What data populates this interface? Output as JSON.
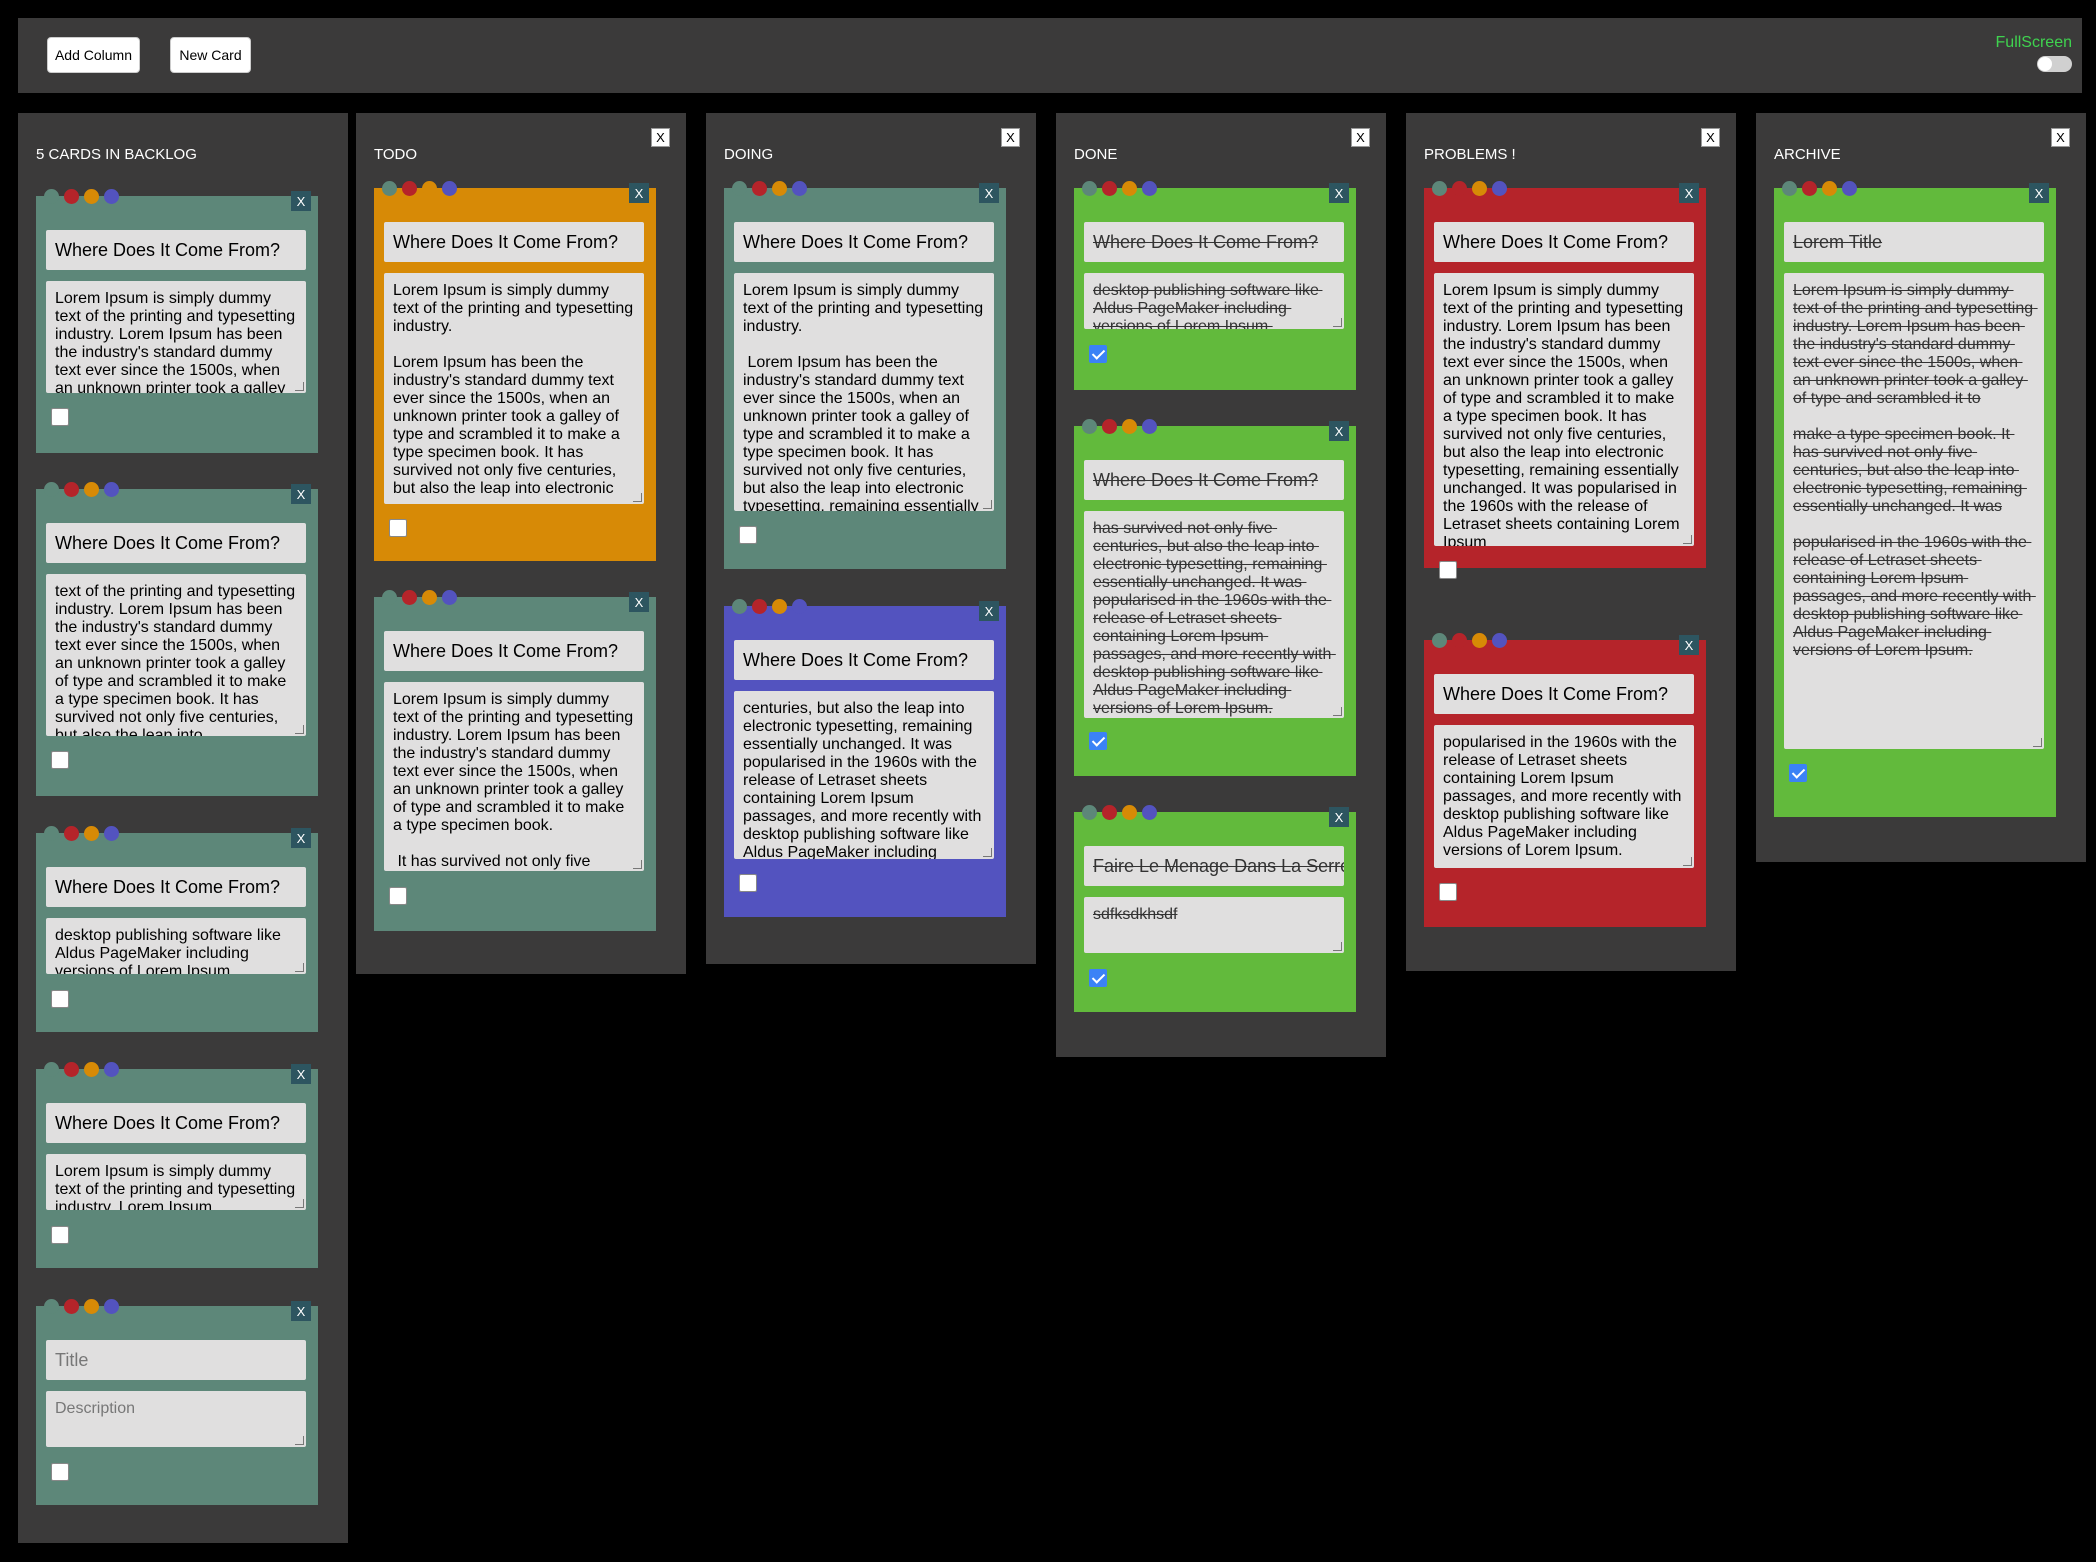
{
  "toolbar": {
    "add_column_label": "Add Column",
    "new_card_label": "New Card",
    "fullscreen_label": "FullScreen"
  },
  "colors": {
    "teal": "#5d8779",
    "orange": "#d78a06",
    "red": "#b5242a",
    "blue": "#5353bf",
    "green": "#62ba3c",
    "panel": "#3b3a3a"
  },
  "close_label": "X",
  "columns": {
    "backlog": {
      "title": "5 CARDS IN BACKLOG",
      "cards": [
        {
          "title": "Where Does It Come From?",
          "desc": "Lorem Ipsum is simply dummy text of the printing and typesetting industry. Lorem Ipsum has been the industry's standard dummy text ever since the 1500s, when an unknown printer took a galley of type"
        },
        {
          "title": "Where Does It Come From?",
          "desc": "text of the printing and typesetting industry. Lorem Ipsum has been the industry's standard dummy text ever since the 1500s, when an unknown printer took a galley of type and scrambled it to make a type specimen book. It has survived not only five centuries, but also the leap into"
        },
        {
          "title": "Where Does It Come From?",
          "desc": "desktop publishing software like Aldus PageMaker including versions of Lorem Ipsum."
        },
        {
          "title": "Where Does It Come From?",
          "desc": "Lorem Ipsum is simply dummy text of the printing and typesetting industry. Lorem Ipsum"
        },
        {
          "title_placeholder": "Title",
          "desc_placeholder": "Description"
        }
      ]
    },
    "todo": {
      "title": "TODO",
      "cards": [
        {
          "title": "Where Does It Come From?",
          "desc": "Lorem Ipsum is simply dummy text of the printing and typesetting industry.\n\nLorem Ipsum has been the industry's standard dummy text ever since the 1500s, when an unknown printer took a galley of type and scrambled it to make a type specimen book. It has survived not only five centuries, but also the leap into electronic"
        },
        {
          "title": "Where Does It Come From?",
          "desc": "Lorem Ipsum is simply dummy text of the printing and typesetting industry. Lorem Ipsum has been the industry's standard dummy text ever since the 1500s, when an unknown printer took a galley of type and scrambled it to make a type specimen book.\n\n It has survived not only five"
        }
      ]
    },
    "doing": {
      "title": "DOING",
      "cards": [
        {
          "title": "Where Does It Come From?",
          "desc": "Lorem Ipsum is simply dummy text of the printing and typesetting industry.\n\n Lorem Ipsum has been the industry's standard dummy text ever since the 1500s, when an unknown printer took a galley of type and scrambled it to make a type specimen book. It has survived not only five centuries, but also the leap into electronic typesetting, remaining essentially"
        },
        {
          "title": "Where Does It Come From?",
          "desc": "centuries, but also the leap into electronic typesetting, remaining essentially unchanged. It was popularised in the 1960s with the release of Letraset sheets containing Lorem Ipsum passages, and more recently with desktop publishing software like Aldus PageMaker including versions of Lorem Ipsum."
        }
      ]
    },
    "done": {
      "title": "DONE",
      "cards": [
        {
          "title": "Where Does It Come From?",
          "desc": "desktop publishing software like Aldus PageMaker including versions of Lorem Ipsum."
        },
        {
          "title": "Where Does It Come From?",
          "desc": "has survived not only five centuries, but also the leap into electronic typesetting, remaining essentially unchanged. It was popularised in the 1960s with the release of Letraset sheets containing Lorem Ipsum passages, and more recently with desktop publishing software like Aldus PageMaker including versions of Lorem Ipsum."
        },
        {
          "title": "Faire Le Menage Dans La Serre",
          "desc": "sdfksdkhsdf"
        }
      ]
    },
    "problems": {
      "title": "PROBLEMS !",
      "cards": [
        {
          "title": "Where Does It Come From?",
          "desc": "Lorem Ipsum is simply dummy text of the printing and typesetting industry. Lorem Ipsum has been the industry's standard dummy text ever since the 1500s, when an unknown printer took a galley of type and scrambled it to make a type specimen book. It has survived not only five centuries, but also the leap into electronic typesetting, remaining essentially unchanged. It was popularised in the 1960s with the release of Letraset sheets containing Lorem Ipsum"
        },
        {
          "title": "Where Does It Come From?",
          "desc": "popularised in the 1960s with the release of Letraset sheets containing Lorem Ipsum passages, and more recently with desktop publishing software like Aldus PageMaker including versions of Lorem Ipsum."
        }
      ]
    },
    "archive": {
      "title": "ARCHIVE",
      "cards": [
        {
          "title": "Lorem Title",
          "desc": "Lorem Ipsum is simply dummy text of the printing and typesetting industry. Lorem Ipsum has been the industry's standard dummy text ever since the 1500s, when an unknown printer took a galley of type and scrambled it to\n\nmake a type specimen book. It has survived not only five centuries, but also the leap into electronic typesetting, remaining essentially unchanged. It was\n\npopularised in the 1960s with the release of Letraset sheets containing Lorem Ipsum passages, and more recently with desktop publishing software like Aldus PageMaker including versions of Lorem Ipsum."
        }
      ]
    }
  }
}
